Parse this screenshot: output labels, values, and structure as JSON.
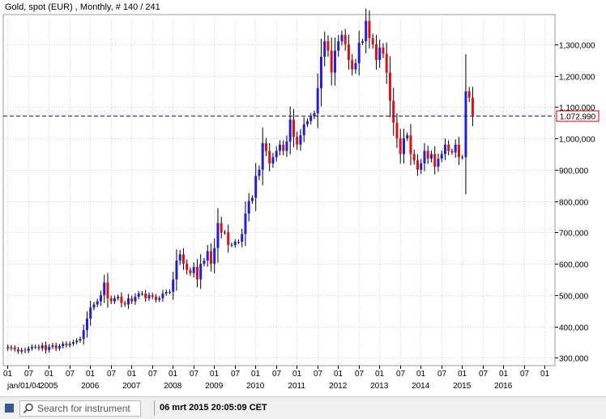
{
  "header": {
    "title": "Gold, spot (EUR) , Monthly, # 140 / 241"
  },
  "footer": {
    "search_placeholder": "Search for instrument",
    "timestamp": "06 mrt 2015 20:05:09 CET"
  },
  "colors": {
    "up": "#2020d8",
    "down": "#e01010",
    "price_line": "#1a1aa8",
    "price_label": "#c00000",
    "axis": "#000000"
  },
  "chart_data": {
    "type": "candlestick",
    "title": "Gold, spot (EUR) , Monthly, # 140 / 241",
    "y_ticks": [
      {
        "value": 300000,
        "label": "300,000"
      },
      {
        "value": 400000,
        "label": "400,000"
      },
      {
        "value": 500000,
        "label": "500,000"
      },
      {
        "value": 600000,
        "label": "600,000"
      },
      {
        "value": 700000,
        "label": "700,000"
      },
      {
        "value": 800000,
        "label": "800,000"
      },
      {
        "value": 900000,
        "label": "900,000"
      },
      {
        "value": 1000000,
        "label": "1,000,000"
      },
      {
        "value": 1100000,
        "label": "1,100,000"
      },
      {
        "value": 1200000,
        "label": "1,200,000"
      },
      {
        "value": 1300000,
        "label": "1,300,000"
      }
    ],
    "ylim": [
      275000,
      1395000
    ],
    "x_start": "2004-01",
    "x_months_visible": 176,
    "x_ticks_month": [
      "01",
      "07",
      "01",
      "07",
      "01",
      "07",
      "01",
      "07",
      "01",
      "07",
      "01",
      "07",
      "01",
      "07",
      "01",
      "07",
      "01",
      "07",
      "01",
      "07",
      "01",
      "07",
      "01",
      "07",
      "01",
      "07",
      "01"
    ],
    "x_ticks_year": [
      "jan/01/04",
      "2005",
      "2006",
      "2007",
      "2008",
      "2009",
      "2010",
      "2011",
      "2012",
      "2013",
      "2014",
      "2015",
      "2016"
    ],
    "current_price": 1072990,
    "current_price_label": "1.072,990",
    "grid": true,
    "closes": [
      330,
      333,
      327,
      320,
      325,
      322,
      330,
      335,
      335,
      330,
      340,
      325,
      335,
      340,
      330,
      337,
      345,
      340,
      345,
      350,
      355,
      360,
      388,
      425,
      460,
      470,
      480,
      500,
      540,
      490,
      480,
      490,
      495,
      475,
      470,
      490,
      480,
      495,
      505,
      505,
      490,
      500,
      495,
      485,
      490,
      505,
      510,
      510,
      550,
      610,
      630,
      600,
      580,
      570,
      590,
      550,
      600,
      610,
      640,
      600,
      650,
      730,
      700,
      700,
      660,
      660,
      670,
      670,
      695,
      760,
      800,
      810,
      880,
      900,
      985,
      960,
      920,
      940,
      960,
      980,
      960,
      990,
      1060,
      1005,
      980,
      1010,
      1045,
      1055,
      1070,
      1080,
      1160,
      1260,
      1310,
      1280,
      1210,
      1280,
      1310,
      1330,
      1300,
      1250,
      1220,
      1240,
      1305,
      1310,
      1375,
      1320,
      1300,
      1250,
      1290,
      1270,
      1210,
      1120,
      1050,
      1000,
      950,
      1000,
      1010,
      950,
      930,
      900,
      920,
      960,
      935,
      950,
      910,
      935,
      950,
      980,
      960,
      955,
      980,
      940,
      940,
      1150,
      1130,
      1073
    ],
    "unit_multiplier": 1000
  }
}
